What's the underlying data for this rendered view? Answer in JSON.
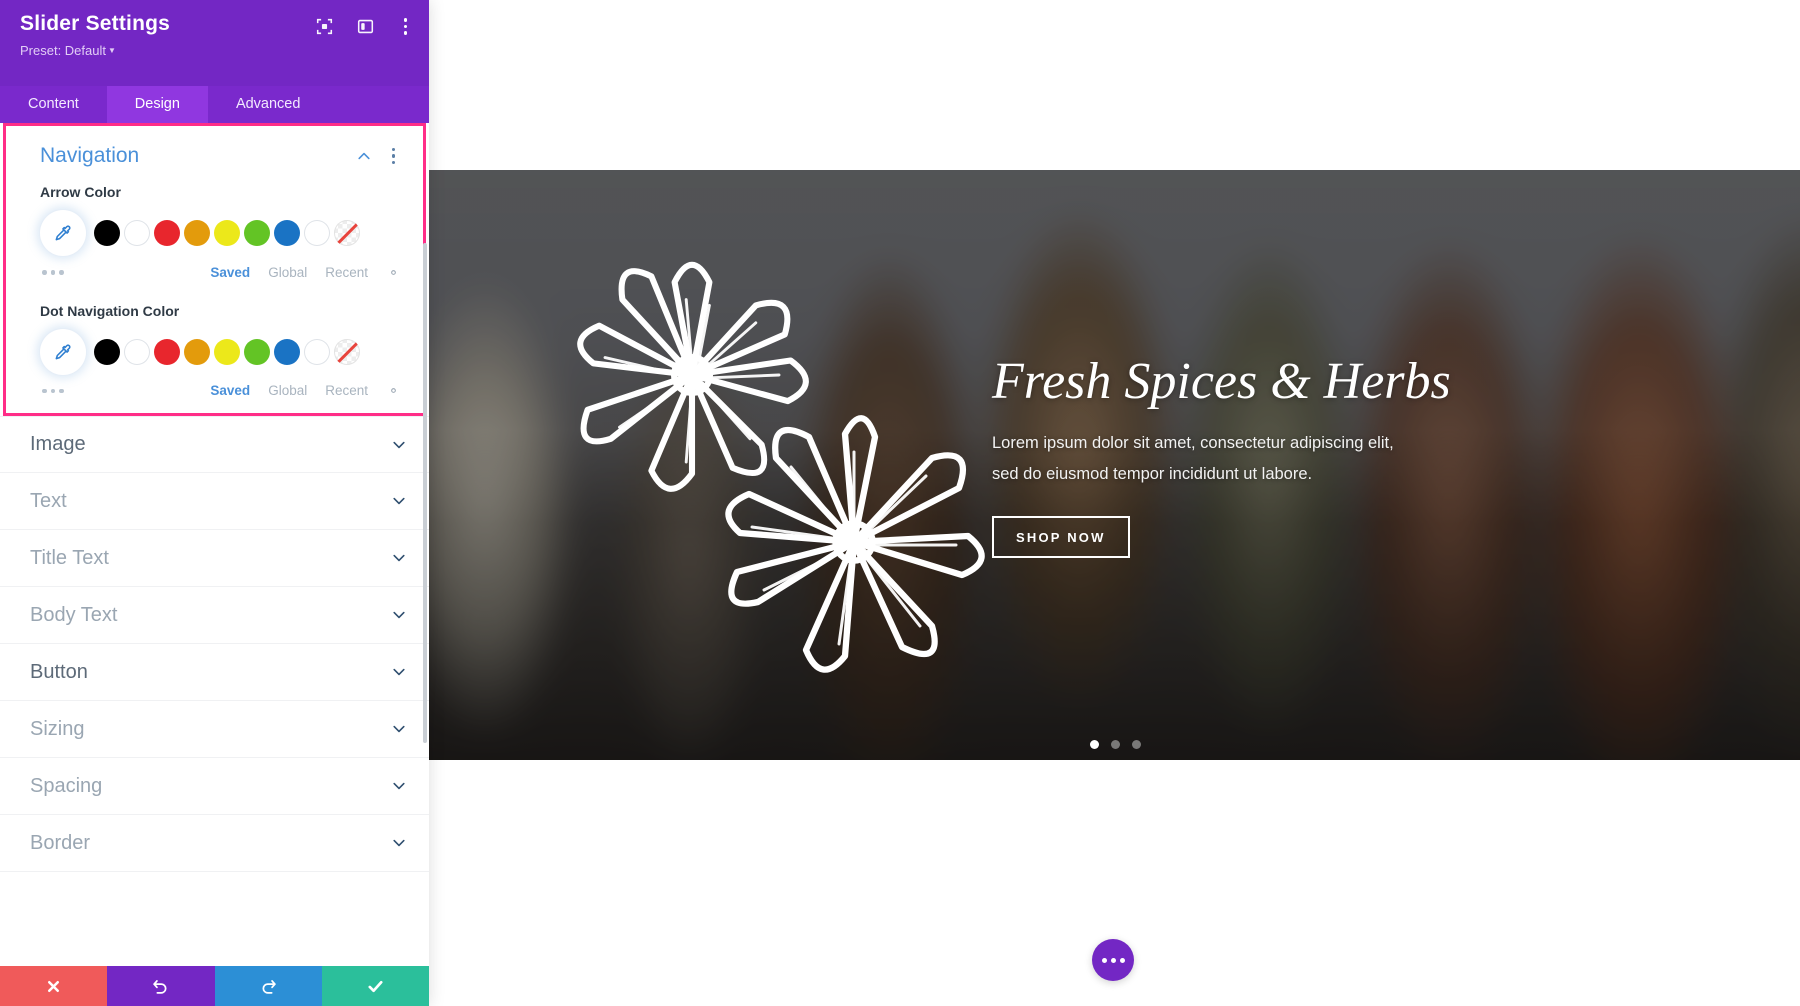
{
  "panel": {
    "title": "Slider Settings",
    "preset_label": "Preset: Default",
    "header_icons": [
      {
        "name": "focus-target-icon"
      },
      {
        "name": "layout-panel-icon"
      },
      {
        "name": "more-options-icon"
      }
    ],
    "tabs": [
      {
        "label": "Content",
        "active": false
      },
      {
        "label": "Design",
        "active": true
      },
      {
        "label": "Advanced",
        "active": false
      }
    ],
    "group": {
      "title": "Navigation",
      "collapse_icon": "chevron-up-icon",
      "options_icon": "more-options-icon",
      "fields": [
        {
          "label": "Arrow Color",
          "picker_icon": "eyedropper-icon",
          "swatches": [
            "#000000",
            "#ffffff",
            "#e8262d",
            "#e39b0c",
            "#ece81a",
            "#63c425",
            "#1a73c4",
            "#ffffff",
            "transparent"
          ],
          "links": [
            {
              "label": "Saved",
              "active": true
            },
            {
              "label": "Global",
              "active": false
            },
            {
              "label": "Recent",
              "active": false
            }
          ],
          "settings_icon": "gear-icon",
          "more_icon": "ellipsis-icon"
        },
        {
          "label": "Dot Navigation Color",
          "picker_icon": "eyedropper-icon",
          "swatches": [
            "#000000",
            "#ffffff",
            "#e8262d",
            "#e39b0c",
            "#ece81a",
            "#63c425",
            "#1a73c4",
            "#ffffff",
            "transparent"
          ],
          "links": [
            {
              "label": "Saved",
              "active": true
            },
            {
              "label": "Global",
              "active": false
            },
            {
              "label": "Recent",
              "active": false
            }
          ],
          "settings_icon": "gear-icon",
          "more_icon": "ellipsis-icon"
        }
      ]
    },
    "sections": [
      {
        "label": "Image"
      },
      {
        "label": "Text"
      },
      {
        "label": "Title Text"
      },
      {
        "label": "Body Text"
      },
      {
        "label": "Button"
      },
      {
        "label": "Sizing"
      },
      {
        "label": "Spacing"
      },
      {
        "label": "Border"
      }
    ],
    "footer": [
      {
        "name": "cancel-button",
        "icon": "close-icon"
      },
      {
        "name": "undo-button",
        "icon": "undo-icon"
      },
      {
        "name": "redo-button",
        "icon": "redo-icon"
      },
      {
        "name": "save-button",
        "icon": "check-icon"
      }
    ],
    "colors": {
      "header_purple": "#7327c4",
      "tab_active": "#9037e0",
      "highlight_pink": "#ff2d87",
      "link_blue": "#4a90d9",
      "cancel_red": "#f05a5a",
      "redo_blue": "#2c8fd6",
      "save_green": "#2bbf9b"
    }
  },
  "canvas": {
    "slide": {
      "title": "Fresh Spices & Herbs",
      "body_line_1": "Lorem ipsum dolor sit amet, consectetur adipiscing elit,",
      "body_line_2": "sed do eiusmod tempor incididunt ut labore.",
      "button_label": "SHOP NOW",
      "dots": [
        {
          "active": true
        },
        {
          "active": false
        },
        {
          "active": false
        }
      ]
    },
    "fab": {
      "name": "page-settings-fab",
      "icon": "ellipsis-icon"
    }
  }
}
